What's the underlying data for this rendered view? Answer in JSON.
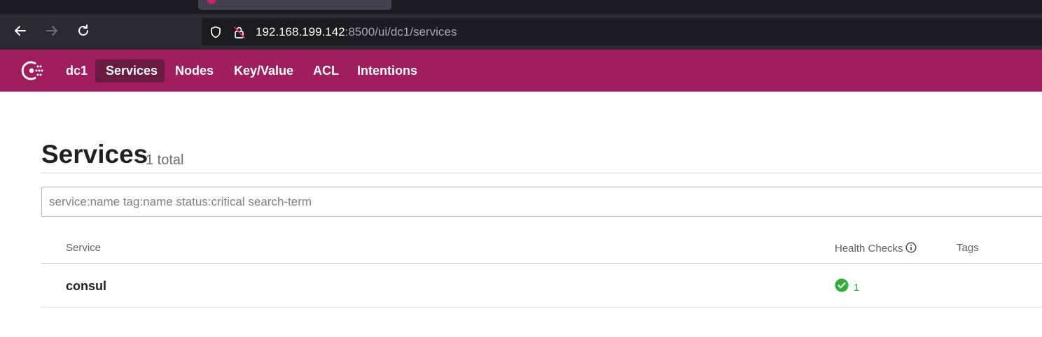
{
  "browser": {
    "url_host": "192.168.199.142",
    "url_rest": ":8500/ui/dc1/services",
    "icons": [
      "back-arrow-icon",
      "forward-arrow-icon",
      "reload-icon",
      "shield-icon",
      "insecure-lock-icon"
    ]
  },
  "nav": {
    "datacenter": "dc1",
    "items": [
      {
        "label": "Services",
        "active": true
      },
      {
        "label": "Nodes",
        "active": false
      },
      {
        "label": "Key/Value",
        "active": false
      },
      {
        "label": "ACL",
        "active": false
      },
      {
        "label": "Intentions",
        "active": false
      }
    ]
  },
  "page": {
    "title": "Services",
    "count_label": "1 total"
  },
  "search": {
    "placeholder": "service:name tag:name status:critical search-term",
    "value": ""
  },
  "table": {
    "headers": {
      "service": "Service",
      "health": "Health Checks",
      "tags": "Tags"
    },
    "rows": [
      {
        "name": "consul",
        "health_passing": "1",
        "tags": ""
      }
    ]
  },
  "colors": {
    "brand": "#a11e5c",
    "nav_active": "#6a1b3f",
    "passing": "#2eb039"
  }
}
